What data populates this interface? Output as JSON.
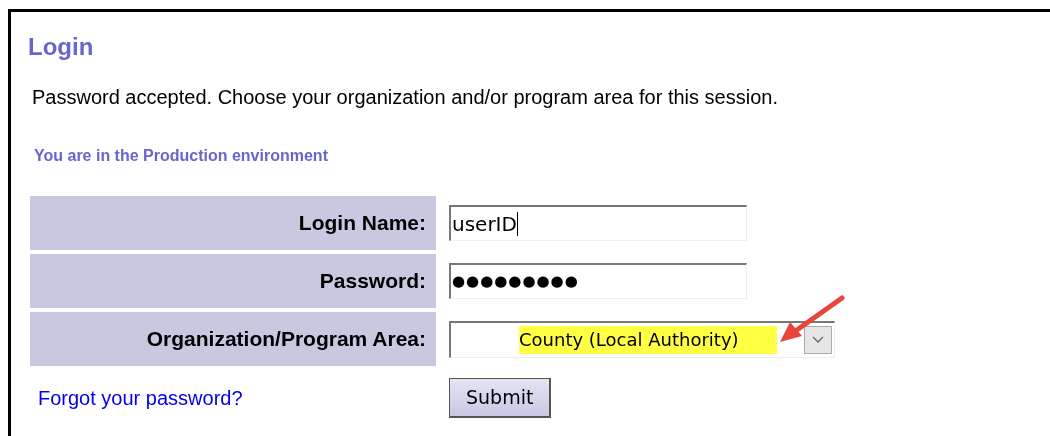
{
  "title": "Login",
  "message": "Password accepted. Choose your organization and/or program area for this session.",
  "environment": "You are in the Production environment",
  "fields": [
    {
      "label": "Login Name:",
      "kind": "text",
      "value": "userID",
      "focused": true
    },
    {
      "label": "Password:",
      "kind": "password",
      "value": "●●●●●●●●●",
      "focused": false
    },
    {
      "label": "Organization/Program Area:",
      "kind": "select",
      "value": "County (Local Authority)",
      "highlighted": true
    }
  ],
  "forgot_link": "Forgot your password?",
  "submit_button": "Submit"
}
